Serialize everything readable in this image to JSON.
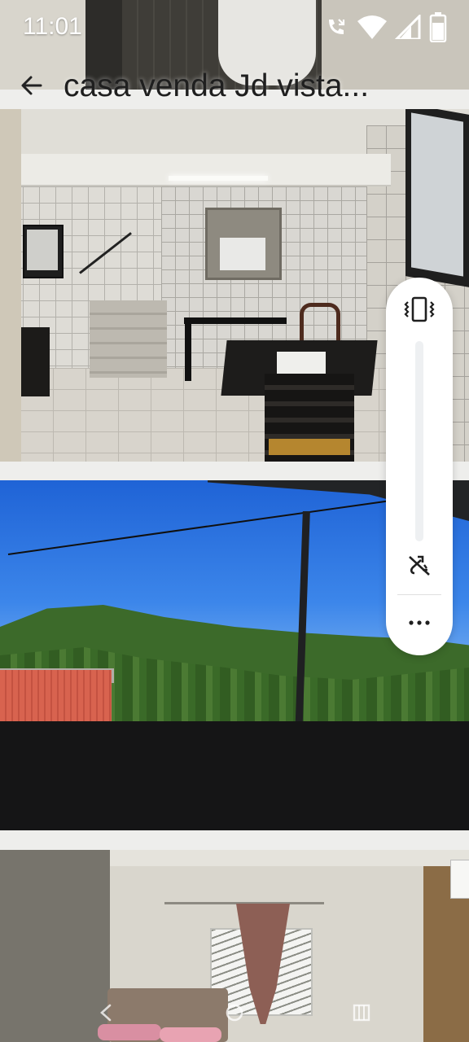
{
  "status_bar": {
    "time": "11:01",
    "icons": [
      "missed-call-icon",
      "wifi-icon",
      "cellular-signal-icon",
      "battery-icon"
    ]
  },
  "app_bar": {
    "back_icon": "back-arrow-icon",
    "title": "casa venda  Jd vista..."
  },
  "gallery": {
    "photos": [
      "bathroom",
      "dining-room",
      "balcony-view",
      "bedroom"
    ]
  },
  "volume_panel": {
    "ringer_mode_icon": "vibrate-icon",
    "level_fraction": 0,
    "live_caption_icon": "live-caption-off-icon",
    "more_icon": "more-options-icon"
  },
  "nav_bar": {
    "buttons": [
      "back-nav-icon",
      "home-nav-icon",
      "recents-nav-icon"
    ]
  },
  "colors": {
    "panel_bg": "#ffffff",
    "panel_track": "#eef0f2",
    "panel_icon": "#1f1f1f"
  }
}
